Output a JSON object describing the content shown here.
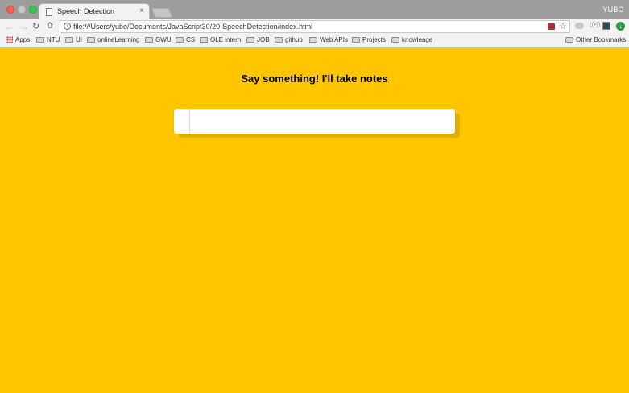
{
  "browser": {
    "tab": {
      "title": "Speech Detection",
      "close": "×"
    },
    "profile_name": "YUBO",
    "url": "file:///Users/yubo/Documents/JavaScript30/20-SpeechDetection/index.html",
    "nav": {
      "back": "←",
      "forward": "→",
      "reload": "↻",
      "star": "☆",
      "info": "i"
    },
    "extensions": {
      "wave": "((•))",
      "green": "↓"
    }
  },
  "bookmarks": {
    "apps": "Apps",
    "folders": [
      "NTU",
      "UI",
      "onlineLearning",
      "GWU",
      "CS",
      "OLE intern",
      "JOB",
      "github",
      "Web APIs",
      "Projects",
      "knowleage"
    ],
    "other": "Other Bookmarks"
  },
  "page": {
    "title": "Say something! I'll take notes",
    "background": "#ffc600"
  }
}
